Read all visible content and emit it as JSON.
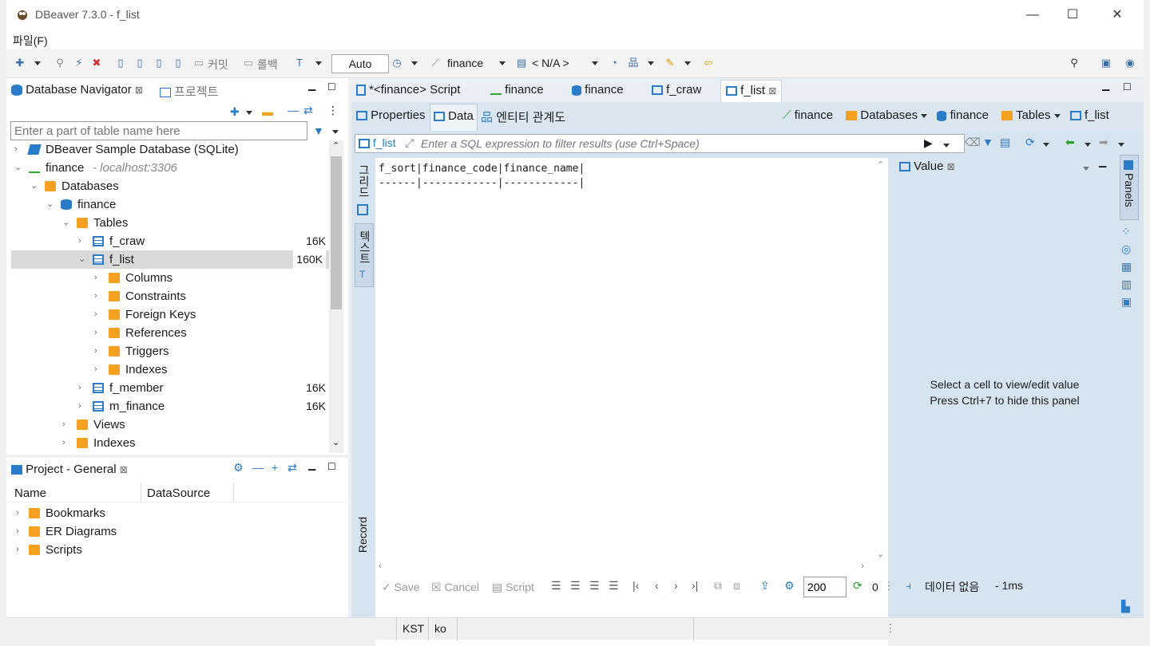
{
  "window": {
    "title": "DBeaver 7.3.0 - f_list",
    "minimize": "—",
    "maximize": "☐",
    "close": "✕"
  },
  "menu": {
    "file": "파일(F)"
  },
  "toolbar": {
    "commit": "커밋",
    "rollback": "롤백",
    "auto": "Auto",
    "connection": "finance",
    "schema": "< N/A >"
  },
  "navigator": {
    "tab_label": "Database Navigator",
    "project_tab_label": "프로젝트",
    "filter_placeholder": "Enter a part of table name here",
    "tree": [
      {
        "label": "DBeaver Sample Database (SQLite)",
        "size": "",
        "extra": ""
      },
      {
        "label": "finance",
        "size": "",
        "extra": "- localhost:3306"
      },
      {
        "label": "Databases",
        "size": "",
        "extra": ""
      },
      {
        "label": "finance",
        "size": "",
        "extra": ""
      },
      {
        "label": "Tables",
        "size": "",
        "extra": ""
      },
      {
        "label": "f_craw",
        "size": "16K",
        "extra": ""
      },
      {
        "label": "f_list",
        "size": "160K",
        "extra": ""
      },
      {
        "label": "Columns",
        "size": "",
        "extra": ""
      },
      {
        "label": "Constraints",
        "size": "",
        "extra": ""
      },
      {
        "label": "Foreign Keys",
        "size": "",
        "extra": ""
      },
      {
        "label": "References",
        "size": "",
        "extra": ""
      },
      {
        "label": "Triggers",
        "size": "",
        "extra": ""
      },
      {
        "label": "Indexes",
        "size": "",
        "extra": ""
      },
      {
        "label": "f_member",
        "size": "16K",
        "extra": ""
      },
      {
        "label": "m_finance",
        "size": "16K",
        "extra": ""
      },
      {
        "label": "Views",
        "size": "",
        "extra": ""
      },
      {
        "label": "Indexes",
        "size": "",
        "extra": ""
      }
    ]
  },
  "project": {
    "tab_label": "Project - General",
    "col_name": "Name",
    "col_datasource": "DataSource",
    "items": [
      {
        "label": "Bookmarks"
      },
      {
        "label": "ER Diagrams"
      },
      {
        "label": "Scripts"
      }
    ]
  },
  "editor": {
    "tabs": [
      {
        "label": "*<finance> Script"
      },
      {
        "label": "finance"
      },
      {
        "label": "finance"
      },
      {
        "label": "f_craw"
      },
      {
        "label": "f_list"
      }
    ],
    "subtabs": {
      "properties": "Properties",
      "data": "Data",
      "er": "엔티티 관계도"
    },
    "breadcrumb": {
      "conn": "finance",
      "databases": "Databases",
      "db": "finance",
      "tables": "Tables",
      "table": "f_list"
    },
    "filter": {
      "table": "f_list",
      "placeholder": "Enter a SQL expression to filter results (use Ctrl+Space)"
    },
    "side_tabs": {
      "grid": "그리드",
      "text": "텍스트",
      "record": "Record"
    },
    "text_header": "f_sort|finance_code|finance_name|",
    "text_divider": "------|------------|------------|",
    "value_panel": {
      "title": "Value",
      "line1": "Select a cell to view/edit value",
      "line2": "Press Ctrl+7 to hide this panel",
      "panels_label": "Panels"
    },
    "bottom": {
      "save": "Save",
      "cancel": "Cancel",
      "script": "Script",
      "fetch_size": "200",
      "row_count": "0",
      "status": "데이터 없음",
      "time": "- 1ms"
    }
  },
  "statusbar": {
    "timezone": "KST",
    "locale": "ko"
  },
  "colors": {
    "accent": "#2a7bc8",
    "folder": "#f4a020",
    "editor_bg": "#d6e4f0"
  }
}
